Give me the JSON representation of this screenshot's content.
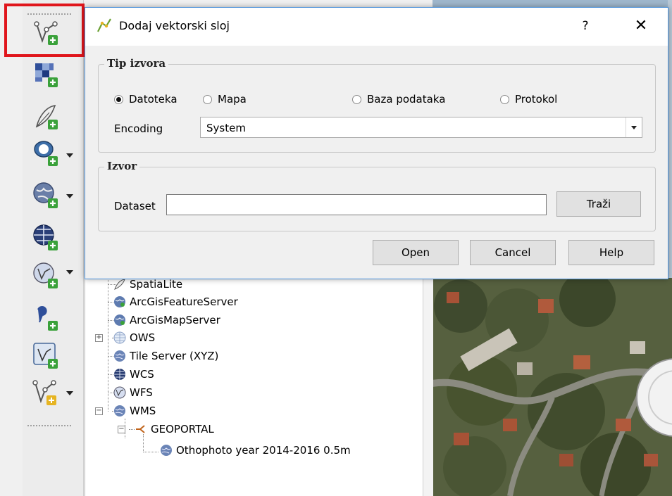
{
  "dialog": {
    "title": "Dodaj vektorski sloj",
    "help_symbol": "?",
    "close_symbol": "✕",
    "source_group": {
      "title": "Tip izvora",
      "options": [
        "Datoteka",
        "Mapa",
        "Baza podataka",
        "Protokol"
      ],
      "selected": "Datoteka",
      "encoding_label": "Encoding",
      "encoding_value": "System"
    },
    "source": {
      "title": "Izvor",
      "dataset_label": "Dataset",
      "dataset_value": "",
      "browse_label": "Traži"
    },
    "buttons": {
      "open": "Open",
      "cancel": "Cancel",
      "help": "Help"
    }
  },
  "browser": {
    "items": [
      {
        "label": "SpatiaLite",
        "icon": "feather-icon"
      },
      {
        "label": "ArcGisFeatureServer",
        "icon": "arcgis-globe-icon"
      },
      {
        "label": "ArcGisMapServer",
        "icon": "arcgis-globe-icon"
      },
      {
        "label": "OWS",
        "icon": "ows-globe-icon"
      },
      {
        "label": "Tile Server (XYZ)",
        "icon": "globe-icon"
      },
      {
        "label": "WCS",
        "icon": "wcs-globe-icon"
      },
      {
        "label": "WFS",
        "icon": "wfs-globe-icon"
      },
      {
        "label": "WMS",
        "icon": "globe-icon"
      },
      {
        "label": "GEOPORTAL",
        "icon": "connection-icon"
      },
      {
        "label": "Othophoto year 2014-2016 0.5m",
        "icon": "globe-icon"
      }
    ]
  },
  "toolbar": {
    "tools": [
      "add-vector-layer-icon",
      "add-raster-layer-icon",
      "add-spatialite-layer-icon",
      "add-postgis-layer-icon",
      "add-wms-layer-icon",
      "add-wcs-layer-icon",
      "add-wfs-layer-icon",
      "add-delimited-text-icon",
      "add-virtual-layer-icon",
      "new-shapefile-layer-icon"
    ]
  },
  "colors": {
    "highlight": "#e0161c",
    "dialog_border": "#4a90d9",
    "icon_green": "#3aa13a",
    "icon_blue": "#2f4f9a"
  }
}
